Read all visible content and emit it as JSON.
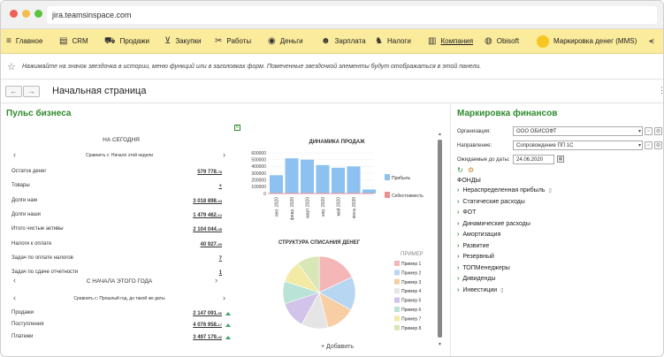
{
  "browser": {
    "url": "jira.teamsinspace.com"
  },
  "nav": {
    "items": [
      {
        "label": "Главное",
        "icon": "menu-icon",
        "glyph": "≡"
      },
      {
        "label": "CRM",
        "icon": "crm-icon",
        "glyph": "▤"
      },
      {
        "label": "Продажи",
        "icon": "cart-icon",
        "glyph": "⛟"
      },
      {
        "label": "Закупки",
        "icon": "basket-icon",
        "glyph": "⊻"
      },
      {
        "label": "Работы",
        "icon": "tools-icon",
        "glyph": "✂"
      },
      {
        "label": "Деньги",
        "icon": "coin-icon",
        "glyph": "◉"
      },
      {
        "label": "Зарплата",
        "icon": "people-icon",
        "glyph": "☻"
      },
      {
        "label": "Налоги",
        "icon": "eagle-icon",
        "glyph": "♞"
      },
      {
        "label": "Компания",
        "icon": "building-icon",
        "glyph": "▥"
      },
      {
        "label": "Obisoft",
        "icon": "obisoft-icon",
        "glyph": "◍"
      },
      {
        "label": "Маркировка денег (MMS)",
        "icon": "coin-gold-icon",
        "glyph": "●"
      }
    ],
    "share_icon": "share-icon"
  },
  "favorites_hint": "Нажимайте на значок звездочка в истории, меню функций или в заголовках форм. Помеченные звездочкой элементы будут отображаться в этой панели.",
  "page": {
    "title": "Начальная страница"
  },
  "pulse": {
    "title": "Пульс бизнеса",
    "today_header": "НА СЕГОДНЯ",
    "today_compare": "Сравнить с: Начало этой недели",
    "today_rows": [
      {
        "label": "Остаток денег",
        "value": "579 778.",
        "dec": "78"
      },
      {
        "label": "Товары",
        "value": "+",
        "dec": ""
      },
      {
        "label": "Долги нам",
        "value": "3 018 898.",
        "dec": "34"
      },
      {
        "label": "Долги наши",
        "value": "1 479 462.",
        "dec": "12"
      },
      {
        "label": "Итого чистые активы",
        "value": "2 104 044.",
        "dec": "45"
      },
      {
        "label": "Налоги к оплате",
        "value": "40 927.",
        "dec": "00"
      },
      {
        "label": "Задач по оплате налогов",
        "value": "7",
        "dec": ""
      },
      {
        "label": "Задач по сдаче отчетности",
        "value": "1",
        "dec": ""
      }
    ],
    "year_header": "С НАЧАЛА ЭТОГО ГОДА",
    "year_compare": "Сравнить с: Прошлый год, до такой же даты",
    "year_rows": [
      {
        "label": "Продажи",
        "value": "2 147 091.",
        "dec": "30"
      },
      {
        "label": "Поступления",
        "value": "4 076 958.",
        "dec": "17"
      },
      {
        "label": "Платежи",
        "value": "3 497 179.",
        "dec": "42"
      }
    ]
  },
  "chart_data": [
    {
      "type": "bar",
      "title": "ДИНАМИКА ПРОДАЖ",
      "categories": [
        "янв. 2020",
        "февр. 2020",
        "март 2020",
        "апр. 2020",
        "май 2020",
        "июнь 2020"
      ],
      "series": [
        {
          "name": "Прибыль",
          "values": [
            270000,
            520000,
            500000,
            420000,
            380000,
            400000,
            60000
          ],
          "color": "#8cc1f0"
        },
        {
          "name": "Себестоимость",
          "values": [
            0,
            0,
            0,
            0,
            0,
            0,
            0
          ],
          "color": "#ef8f8f"
        }
      ],
      "bar_values": [
        270000,
        520000,
        500000,
        420000,
        380000,
        400000,
        60000
      ],
      "ylim": [
        0,
        600000
      ],
      "yticks": [
        "0",
        "100000",
        "200000",
        "300000",
        "400000",
        "500000",
        "600000"
      ],
      "legend": [
        "Прибыль",
        "Себестоимость"
      ],
      "legend_position": "right"
    },
    {
      "type": "pie",
      "title": "СТРУКТУРА СПИСАНИЯ ДЕНЕГ",
      "legend_title": "ПРИМЕР",
      "labels": [
        "Пример 1",
        "Пример 2",
        "Пример 3",
        "Пример 4",
        "Пример 5",
        "Пример 6",
        "Пример 7",
        "Пример 8"
      ],
      "values": [
        18,
        15,
        13,
        12,
        12,
        10,
        10,
        10
      ],
      "colors": [
        "#f4b6b6",
        "#b7d6f2",
        "#f8cfa4",
        "#e5e5e5",
        "#d1c3ea",
        "#b9e3d6",
        "#f3eaa6",
        "#d7e8b6"
      ]
    }
  ],
  "add_label": "+ Добавить",
  "finance": {
    "title": "Маркировка финансов",
    "org_label": "Организация:",
    "org_value": "ООО ОБИСОФТ",
    "dir_label": "Направление:",
    "dir_value": "Сопровождение ПП 1С",
    "date_label": "Ожидаемые до даты:",
    "date_value": "24.06.2020",
    "funds_header": "ФОНДЫ",
    "funds": [
      "Нераспределенная прибыль",
      "Статические расходы",
      "ФОТ",
      "Динамические расходы",
      "Амортизация",
      "Развитие",
      "Резервный",
      "ТОПМенеджеры",
      "Дивиденды",
      "Инвестиции"
    ]
  }
}
